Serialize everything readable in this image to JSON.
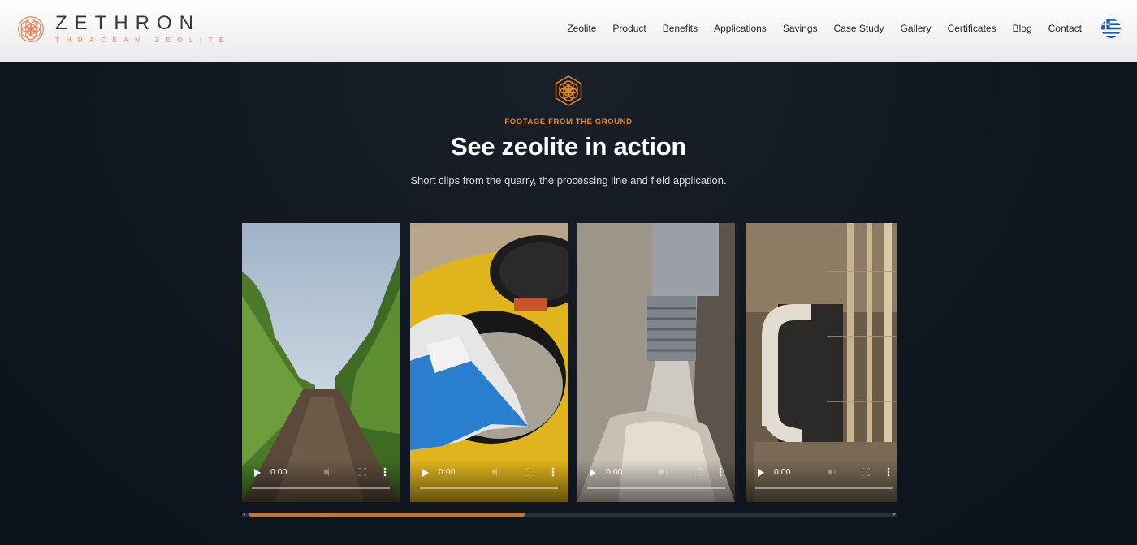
{
  "brand": {
    "name": "ZETHRON",
    "tagline": "THRACEAN ZEOLITE",
    "logo_icon": "flower-of-life-icon"
  },
  "nav": {
    "items": [
      "Zeolite",
      "Product",
      "Benefits",
      "Applications",
      "Savings",
      "Case Study",
      "Gallery",
      "Certificates",
      "Blog",
      "Contact"
    ],
    "language_icon": "greek-flag-icon"
  },
  "hero": {
    "icon": "flower-of-life-icon",
    "eyebrow": "FOOTAGE FROM THE GROUND",
    "title": "See zeolite in action",
    "subtitle": "Short clips from the quarry, the processing line and field application."
  },
  "videos": [
    {
      "time": "0:00",
      "icons": [
        "play-icon",
        "volume-icon",
        "fullscreen-icon",
        "more-icon"
      ]
    },
    {
      "time": "0:00",
      "icons": [
        "play-icon",
        "volume-icon",
        "fullscreen-icon",
        "more-icon"
      ]
    },
    {
      "time": "0:00",
      "icons": [
        "play-icon",
        "volume-icon",
        "fullscreen-icon",
        "more-icon"
      ]
    },
    {
      "time": "0:00",
      "icons": [
        "play-icon",
        "volume-icon",
        "fullscreen-icon",
        "more-icon"
      ]
    }
  ],
  "carousel": {
    "scroll_position": 0.0,
    "visible_fraction": 0.43
  },
  "colors": {
    "accent": "#e2892f",
    "brand_orange": "#e88a5a",
    "background": "#0f1621",
    "header_bg": "#f3f3f3",
    "scroll_thumb": "#b87a3c"
  }
}
